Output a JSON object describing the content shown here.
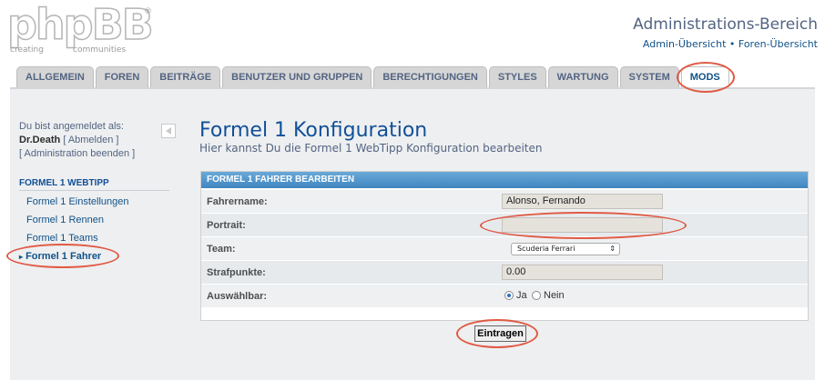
{
  "header": {
    "logo_word": "phpBB",
    "logo_registered": "®",
    "logo_tagline_left": "creating",
    "logo_tagline_right": "communities",
    "title": "Administrations-Bereich",
    "links": [
      "Admin-Übersicht",
      "Foren-Übersicht"
    ],
    "links_separator": "•"
  },
  "tabs": [
    {
      "label": "ALLGEMEIN"
    },
    {
      "label": "FOREN"
    },
    {
      "label": "BEITRÄGE"
    },
    {
      "label": "BENUTZER UND GRUPPEN"
    },
    {
      "label": "BERECHTIGUNGEN"
    },
    {
      "label": "STYLES"
    },
    {
      "label": "WARTUNG"
    },
    {
      "label": "SYSTEM"
    },
    {
      "label": "MODS",
      "active": true
    }
  ],
  "sidebar": {
    "logged_in_text": "Du bist angemeldet als:",
    "username": "Dr.Death",
    "logout": "[ Abmelden ]",
    "end_admin": "[ Administration beenden ]",
    "menu_heading": "FORMEL 1 WEBTIPP",
    "items": [
      {
        "label": "Formel 1 Einstellungen"
      },
      {
        "label": "Formel 1 Rennen"
      },
      {
        "label": "Formel 1 Teams"
      },
      {
        "label": "Formel 1 Fahrer",
        "active": true
      }
    ]
  },
  "main": {
    "title": "Formel 1 Konfiguration",
    "description": "Hier kannst Du die Formel 1 WebTipp Konfiguration bearbeiten",
    "form": {
      "heading": "FORMEL 1 FAHRER BEARBEITEN",
      "rows": [
        {
          "label": "Fahrername:",
          "value": "Alonso, Fernando"
        },
        {
          "label": "Portrait:",
          "value": ""
        },
        {
          "label": "Team:",
          "value": "Scuderia Ferrari"
        },
        {
          "label": "Strafpunkte:",
          "value": "0.00"
        },
        {
          "label": "Auswählbar:",
          "options": [
            "Ja",
            "Nein"
          ],
          "selected": "Ja"
        }
      ]
    },
    "submit_label": "Eintragen"
  },
  "colors": {
    "accent": "#105289",
    "form_header": "#4b94cc",
    "annotation": "#e05a44"
  }
}
